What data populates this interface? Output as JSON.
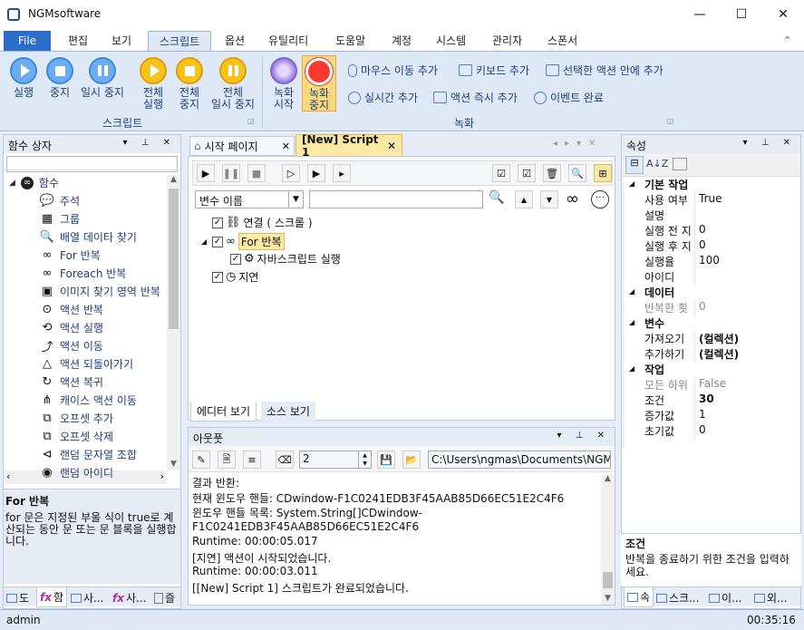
{
  "window": {
    "title": "NGMsoftware",
    "minimize": "—",
    "maximize": "☐",
    "close": "✕"
  },
  "ribbon_tabs": [
    "File",
    "편집",
    "보기",
    "스크립트",
    "옵션",
    "유틸리티",
    "도움말",
    "계정",
    "시스템",
    "관리자",
    "스폰서"
  ],
  "ribbon": {
    "script_buttons": [
      {
        "l1": "실행",
        "l2": ""
      },
      {
        "l1": "중지",
        "l2": ""
      },
      {
        "l1": "일시 중지",
        "l2": ""
      },
      {
        "l1": "전체",
        "l2": "실행"
      },
      {
        "l1": "전체",
        "l2": "중지"
      },
      {
        "l1": "전체",
        "l2": "일시 중지"
      }
    ],
    "script_group": "스크립트",
    "record_start": {
      "l1": "녹화",
      "l2": "시작"
    },
    "record_stop": {
      "l1": "녹화",
      "l2": "중지"
    },
    "record_row1": [
      "마우스 이동 추가",
      "키보드 추가",
      "선택한 액션 안에 추가"
    ],
    "record_row2": [
      "실시간 추가",
      "액션 즉시 추가",
      "이벤트 완료"
    ],
    "record_group": "녹화"
  },
  "func_panel": {
    "title": "함수 상자",
    "root": "함수",
    "items": [
      {
        "icon": "comment-icon",
        "glyph": "💬",
        "label": "주석"
      },
      {
        "icon": "group-icon",
        "glyph": "▦",
        "label": "그룹"
      },
      {
        "icon": "search-icon",
        "glyph": "🔍",
        "label": "배열 데이타 찾기"
      },
      {
        "icon": "loop-icon",
        "glyph": "∞",
        "label": "For 반복"
      },
      {
        "icon": "loop-icon",
        "glyph": "∞",
        "label": "Foreach 반복"
      },
      {
        "icon": "image-search-icon",
        "glyph": "▣",
        "label": "이미지 찾기 영역 반복"
      },
      {
        "icon": "action-loop-icon",
        "glyph": "⊙",
        "label": "액션 반복"
      },
      {
        "icon": "action-run-icon",
        "glyph": "⟲",
        "label": "액션 실행"
      },
      {
        "icon": "action-move-icon",
        "glyph": "⤴",
        "label": "액션 이동"
      },
      {
        "icon": "action-back-icon",
        "glyph": "△",
        "label": "액션 되돌아가기"
      },
      {
        "icon": "action-copy-icon",
        "glyph": "↻",
        "label": "액션 복귀"
      },
      {
        "icon": "case-icon",
        "glyph": "⋔",
        "label": "캐이스 액션 이동"
      },
      {
        "icon": "offset-add-icon",
        "glyph": "⧉",
        "label": "오프셋 추가"
      },
      {
        "icon": "offset-del-icon",
        "glyph": "⧉",
        "label": "오프셋 삭제"
      },
      {
        "icon": "random-icon",
        "glyph": "⊲",
        "label": "랜덤 문자열 조합"
      },
      {
        "icon": "random-id-icon",
        "glyph": "◉",
        "label": "랜덤 아이디"
      }
    ],
    "desc_title": "For 반복",
    "desc_text": "for 문은 지정된 부울 식이 true로 계산되는 동안 문 또는 문 블록을 실행합니다.",
    "bottom_tabs": [
      "도",
      "함",
      "사...",
      "사...",
      "즐"
    ]
  },
  "editor": {
    "tabs": [
      "시작 페이지",
      "[New] Script 1"
    ],
    "var_select": "변수 이름",
    "tree": [
      {
        "label": "연결 ( 스크롤 )",
        "indent": 0
      },
      {
        "label": "For 반복",
        "indent": 0
      },
      {
        "label": "자바스크립트 실행",
        "indent": 1
      },
      {
        "label": "지연",
        "indent": 0
      }
    ],
    "view_tabs": [
      "에디터 보기",
      "소스 보기"
    ]
  },
  "output": {
    "title": "아웃풋",
    "count": "2",
    "path": "C:\\Users\\ngmas\\Documents\\NGM6\\",
    "lines": [
      "결과 반환:",
      "현재 윈도우 핸들: CDwindow-F1C0241EDB3F45AAB85D66EC51E2C4F6",
      "윈도우 핸들 목록: System.String[]CDwindow-",
      "F1C0241EDB3F45AAB85D66EC51E2C4F6",
      "Runtime: 00:00:05.017",
      "[지연] 액션이 시작되었습니다.",
      "Runtime: 00:00:03.011",
      "[[New] Script 1] 스크립트가 완료되었습니다."
    ]
  },
  "props": {
    "title": "속성",
    "sections": [
      {
        "name": "기본 작업",
        "rows": [
          [
            "사용 여부",
            "True"
          ],
          [
            "설명",
            ""
          ],
          [
            "실행 전 지",
            "0"
          ],
          [
            "실행 후 지",
            "0"
          ],
          [
            "실행율",
            "100"
          ],
          [
            "아이디",
            ""
          ]
        ]
      },
      {
        "name": "데이터",
        "rows": [
          [
            "반복한 횟",
            "0"
          ]
        ]
      },
      {
        "name": "변수",
        "rows": [
          [
            "가져오기",
            "(컬렉션)"
          ],
          [
            "추가하기",
            "(컬렉션)"
          ]
        ]
      },
      {
        "name": "작업",
        "rows": [
          [
            "모든 하위",
            "False"
          ],
          [
            "조건",
            "30"
          ],
          [
            "증가값",
            "1"
          ],
          [
            "초기값",
            "0"
          ]
        ]
      }
    ],
    "desc_title": "조건",
    "desc_text": "반복을 종료하기 위한 조건을 입력하세요.",
    "bottom_tabs": [
      "속",
      "스크...",
      "이...",
      "외..."
    ]
  },
  "status": {
    "user": "admin",
    "time": "00:35:16"
  }
}
